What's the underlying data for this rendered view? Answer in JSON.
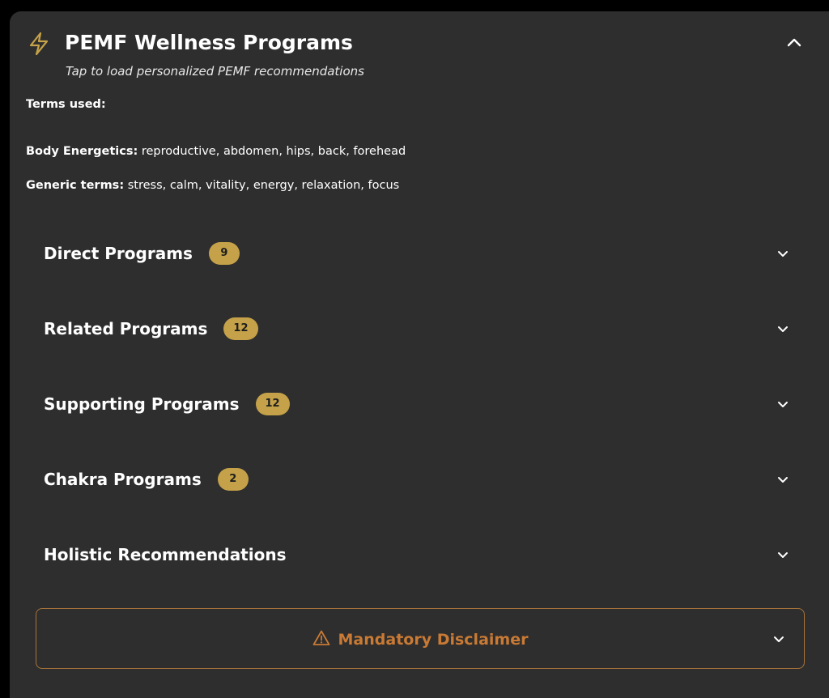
{
  "header": {
    "title": "PEMF Wellness Programs",
    "subtitle": "Tap to load personalized PEMF recommendations",
    "icon": "lightning-bolt-icon",
    "accent_color": "#c5a249"
  },
  "terms": {
    "heading": "Terms used:",
    "body_energetics_label": "Body Energetics:",
    "body_energetics_value": " reproductive, abdomen, hips, back, forehead",
    "generic_label": "Generic terms:",
    "generic_value": " stress, calm, vitality, energy, relaxation, focus"
  },
  "sections": [
    {
      "label": "Direct Programs",
      "count": "9"
    },
    {
      "label": "Related Programs",
      "count": "12"
    },
    {
      "label": "Supporting Programs",
      "count": "12"
    },
    {
      "label": "Chakra Programs",
      "count": "2"
    },
    {
      "label": "Holistic Recommendations"
    }
  ],
  "disclaimer": {
    "label": "Mandatory Disclaimer",
    "icon": "warning-triangle-icon",
    "color": "#c97a34",
    "border_color": "#a8733a"
  }
}
